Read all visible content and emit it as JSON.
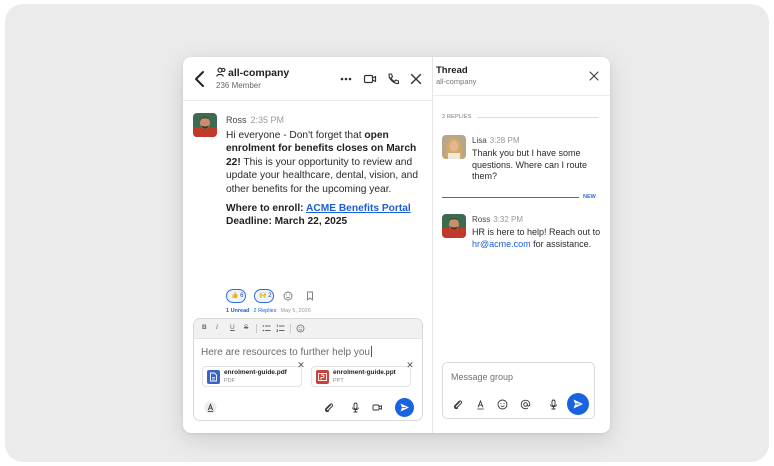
{
  "chat": {
    "channel_name": "all-company",
    "member_count": "236 Member",
    "message": {
      "author": "Ross",
      "time": "2:35 PM",
      "line_intro": "Hi everyone - Don't forget that ",
      "line_bold": "open enrolment for benefits closes on March 22!",
      "line_rest": " This is your opportunity to review and update your healthcare, dental, vision, and other benefits for the upcoming year.",
      "where_label": "Where to enroll: ",
      "portal_link": "ACME Benefits Portal",
      "deadline": "Deadline: March 22, 2025",
      "reactions": [
        {
          "emoji": "👍",
          "count": "6"
        },
        {
          "emoji": "🙌",
          "count": "2"
        }
      ],
      "unread": "1 Unread",
      "replies": "2 Replies",
      "date": "May 5, 2026"
    },
    "composer": {
      "format_buttons": [
        "B",
        "I",
        "U",
        "S"
      ],
      "text": "Here are resources to further help you",
      "attachments": [
        {
          "name": "enrolment-guide.pdf",
          "type": "PDF",
          "color": "#3b64c8"
        },
        {
          "name": "enrolment-guide.ppt",
          "type": "PPT",
          "color": "#c8423b"
        }
      ]
    }
  },
  "thread": {
    "title": "Thread",
    "subtitle": "all-company",
    "replies_label": "2 REPLIES",
    "new_label": "NEW",
    "replies": [
      {
        "author": "Lisa",
        "time": "3:28 PM",
        "text": "Thank you but I have some questions. Where can I route them?"
      },
      {
        "author": "Ross",
        "time": "3:32 PM",
        "text_before": "HR is here to help! Reach out to ",
        "email": "hr@acme.com",
        "text_after": " for assistance."
      }
    ],
    "composer_placeholder": "Message group"
  },
  "colors": {
    "accent": "#1a63e0",
    "link": "#1a5fd6",
    "background": "#ebebeb"
  }
}
